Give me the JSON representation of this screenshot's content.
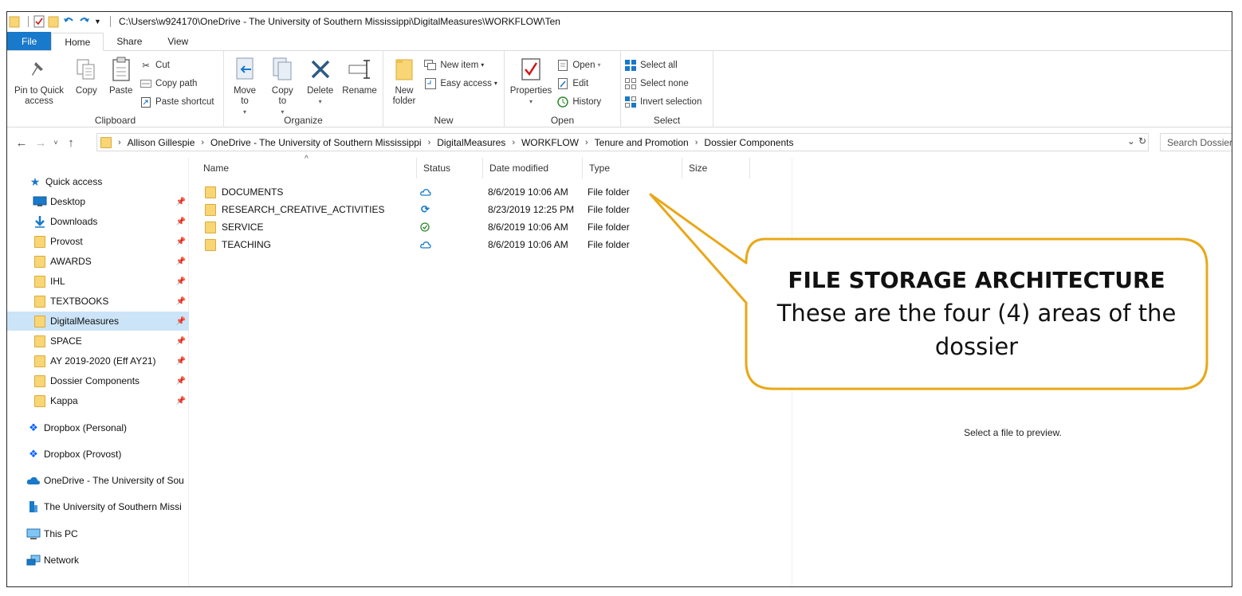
{
  "title_path": "C:\\Users\\w924170\\OneDrive - The University of Southern Mississippi\\DigitalMeasures\\WORKFLOW\\Ten",
  "tabs": [
    "File",
    "Home",
    "Share",
    "View"
  ],
  "ribbon": {
    "clipboard": {
      "pin": "Pin to Quick access",
      "copy": "Copy",
      "paste": "Paste",
      "cut": "Cut",
      "copy_path": "Copy path",
      "paste_shortcut": "Paste shortcut",
      "label": "Clipboard"
    },
    "organize": {
      "move_to": "Move to",
      "copy_to": "Copy to",
      "delete": "Delete",
      "rename": "Rename",
      "label": "Organize"
    },
    "new": {
      "new_folder": "New folder",
      "new_item": "New item",
      "easy_access": "Easy access",
      "label": "New"
    },
    "open": {
      "properties": "Properties",
      "open": "Open",
      "edit": "Edit",
      "history": "History",
      "label": "Open"
    },
    "select": {
      "select_all": "Select all",
      "select_none": "Select none",
      "invert": "Invert selection",
      "label": "Select"
    }
  },
  "breadcrumb": [
    "Allison Gillespie",
    "OneDrive - The University of Southern Mississippi",
    "DigitalMeasures",
    "WORKFLOW",
    "Tenure and Promotion",
    "Dossier Components"
  ],
  "search_placeholder": "Search Dossier",
  "nav": {
    "quick_access": "Quick access",
    "pinned": [
      "Desktop",
      "Downloads",
      "Provost",
      "AWARDS",
      "IHL",
      "TEXTBOOKS",
      "DigitalMeasures",
      "SPACE",
      "AY 2019-2020 (Eff AY21)",
      "Dossier Components",
      "Kappa"
    ],
    "selected": "DigitalMeasures",
    "roots": [
      "Dropbox (Personal)",
      "Dropbox (Provost)",
      "OneDrive - The University of Sou",
      "The University of Southern Missi",
      "This PC",
      "Network"
    ]
  },
  "columns": {
    "name": "Name",
    "status": "Status",
    "date": "Date modified",
    "type": "Type",
    "size": "Size"
  },
  "files": [
    {
      "name": "DOCUMENTS",
      "status": "cloud",
      "date": "8/6/2019 10:06 AM",
      "type": "File folder"
    },
    {
      "name": "RESEARCH_CREATIVE_ACTIVITIES",
      "status": "sync",
      "date": "8/23/2019 12:25 PM",
      "type": "File folder"
    },
    {
      "name": "SERVICE",
      "status": "check",
      "date": "8/6/2019 10:06 AM",
      "type": "File folder"
    },
    {
      "name": "TEACHING",
      "status": "cloud",
      "date": "8/6/2019 10:06 AM",
      "type": "File folder"
    }
  ],
  "preview_text": "Select a file to preview.",
  "callout": {
    "title": "FILE STORAGE ARCHITECTURE",
    "body": "These are the four (4) areas of the dossier"
  },
  "colors": {
    "accent": "#1979ca",
    "callout_border": "#e8a818",
    "folder": "#f8d675",
    "selected": "#cce4f7"
  }
}
